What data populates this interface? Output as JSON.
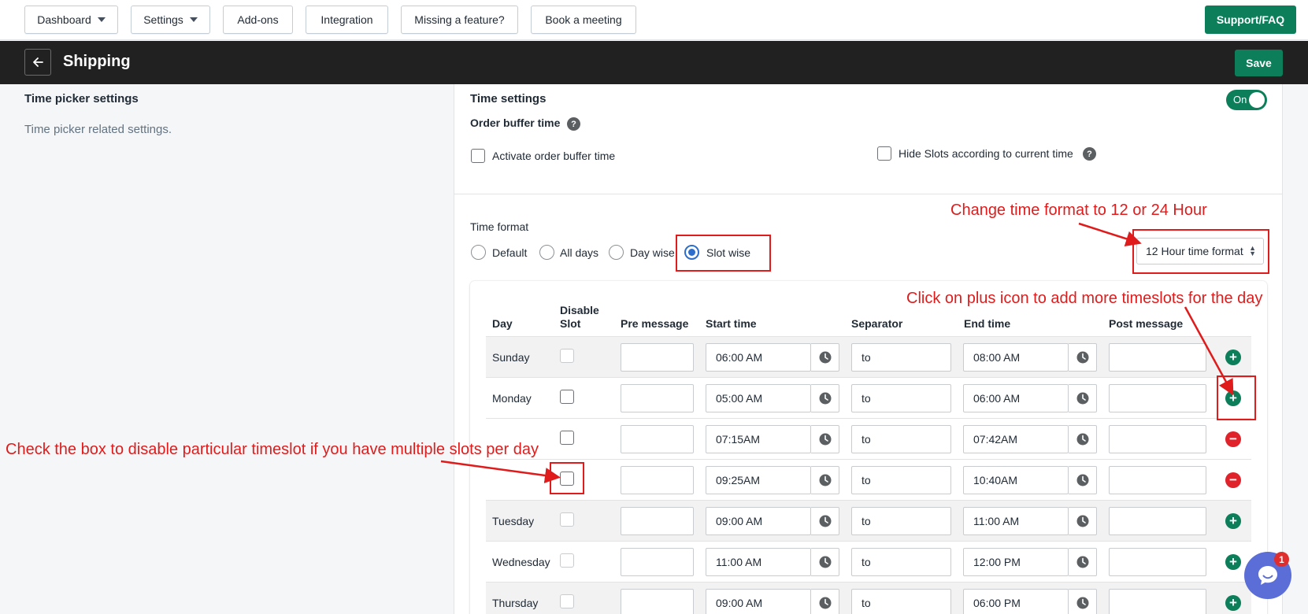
{
  "topbar": {
    "dashboard": "Dashboard",
    "settings": "Settings",
    "addons": "Add-ons",
    "integration": "Integration",
    "missing_feature": "Missing a feature?",
    "book_meeting": "Book a meeting",
    "support": "Support/FAQ"
  },
  "header": {
    "title": "Shipping",
    "save": "Save"
  },
  "left_section": {
    "title": "Time picker settings",
    "description": "Time picker related settings."
  },
  "time_settings": {
    "title": "Time settings",
    "toggle_label": "On",
    "order_buffer_title": "Order buffer time",
    "activate_buffer_label": "Activate order buffer time",
    "hide_slots_label": "Hide Slots according to current time",
    "help_glyph": "?"
  },
  "time_format": {
    "label": "Time format",
    "options": [
      "Default",
      "All days",
      "Day wise",
      "Slot wise"
    ],
    "selected": "Slot wise",
    "select_value": "12 Hour time format"
  },
  "table": {
    "headers": {
      "day": "Day",
      "disable_slot_line1": "Disable",
      "disable_slot_line2": "Slot",
      "pre_message": "Pre message",
      "start_time": "Start time",
      "separator": "Separator",
      "end_time": "End time",
      "post_message": "Post message"
    },
    "rows": [
      {
        "day": "Sunday",
        "start": "06:00 AM",
        "sep": "to",
        "end": "08:00 AM"
      },
      {
        "day": "Monday",
        "start": "05:00 AM",
        "sep": "to",
        "end": "06:00 AM"
      },
      {
        "day": "",
        "start": "07:15AM",
        "sep": "to",
        "end": "07:42AM"
      },
      {
        "day": "",
        "start": "09:25AM",
        "sep": "to",
        "end": "10:40AM"
      },
      {
        "day": "Tuesday",
        "start": "09:00 AM",
        "sep": "to",
        "end": "11:00 AM"
      },
      {
        "day": "Wednesday",
        "start": "11:00 AM",
        "sep": "to",
        "end": "12:00 PM"
      },
      {
        "day": "Thursday",
        "start": "09:00 AM",
        "sep": "to",
        "end": "06:00 PM"
      }
    ],
    "plus_glyph": "+",
    "minus_glyph": "−"
  },
  "annotations": {
    "time_format_note": "Change time format to 12 or 24 Hour",
    "plus_note": "Click on plus icon to add more timeslots for the day",
    "checkbox_note": "Check the box to disable particular timeslot if you have multiple slots per day"
  },
  "chat": {
    "badge_count": "1"
  },
  "colors": {
    "primary_green": "#0c7e5a",
    "header_dark": "#212121",
    "annotation_red": "#e01b1b",
    "radio_blue": "#2c6ecb",
    "remove_red": "#e0232b"
  }
}
